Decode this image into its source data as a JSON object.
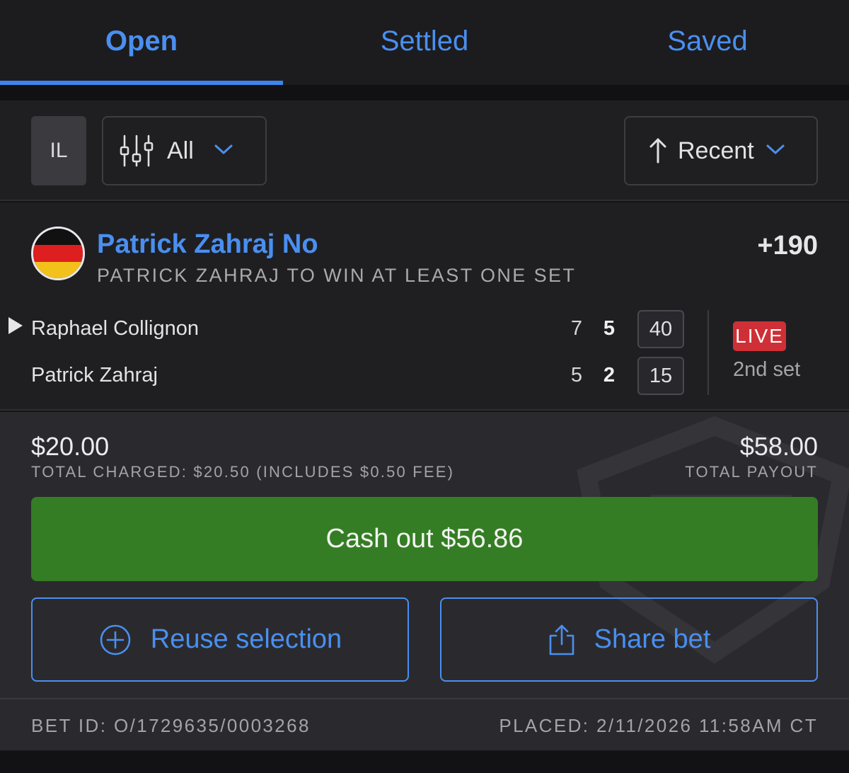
{
  "tabs": [
    {
      "label": "Open",
      "active": true
    },
    {
      "label": "Settled",
      "active": false
    },
    {
      "label": "Saved",
      "active": false
    }
  ],
  "filters": {
    "state": "IL",
    "filter_label": "All",
    "filter_icon": "sliders-icon",
    "sort_label": "Recent",
    "sort_icon": "arrow-up-icon"
  },
  "bet": {
    "selection": "Patrick Zahraj No",
    "market": "PATRICK ZAHRAJ TO WIN AT LEAST ONE SET",
    "odds": "+190",
    "flag": "germany-flag",
    "match": {
      "players": [
        {
          "name": "Raphael Collignon",
          "serving": true,
          "set1": "7",
          "set2": "5",
          "points": "40"
        },
        {
          "name": "Patrick Zahraj",
          "serving": false,
          "set1": "5",
          "set2": "2",
          "points": "15"
        }
      ],
      "status": "LIVE",
      "period": "2nd set"
    },
    "wager": "$20.00",
    "charged": "TOTAL CHARGED: $20.50 (INCLUDES $0.50 FEE)",
    "payout": "$58.00",
    "payout_label": "TOTAL PAYOUT",
    "cashout_label": "Cash out $56.86",
    "reuse_label": "Reuse selection",
    "share_label": "Share bet",
    "bet_id": "BET ID: O/1729635/0003268",
    "placed": "PLACED: 2/11/2026 11:58AM CT"
  },
  "colors": {
    "accent": "#4a8ff0",
    "cashout": "#347d24",
    "live": "#cf2f36"
  }
}
